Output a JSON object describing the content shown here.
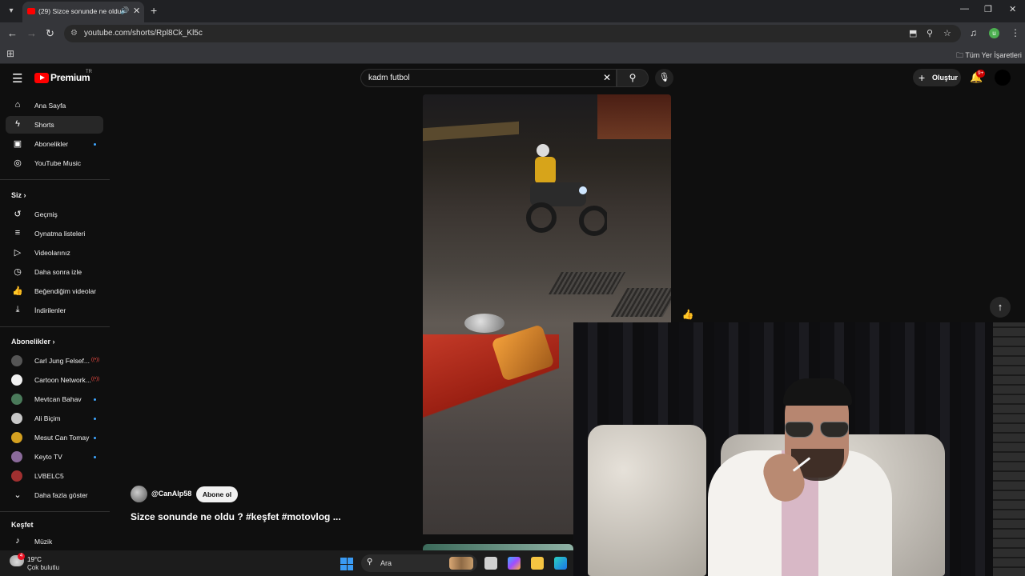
{
  "browser": {
    "tab_title": "(29) Sizce sonunde ne oldu",
    "url": "youtube.com/shorts/Rpl8Ck_Kl5c",
    "bookmarks_all": "Tüm Yer İşaretleri",
    "profile_initial": "u"
  },
  "masthead": {
    "logo_text": "Premium",
    "country_code": "TR",
    "search_query": "kadm futbol",
    "create_label": "Oluştur",
    "notification_count": "9+"
  },
  "sidebar": {
    "main": [
      {
        "label": "Ana Sayfa",
        "icon": "home-icon"
      },
      {
        "label": "Shorts",
        "icon": "shorts-icon"
      },
      {
        "label": "Abonelikler",
        "icon": "subscriptions-icon"
      },
      {
        "label": "YouTube Music",
        "icon": "music-icon"
      }
    ],
    "you_header": "Siz",
    "you": [
      {
        "label": "Geçmiş",
        "icon": "history-icon"
      },
      {
        "label": "Oynatma listeleri",
        "icon": "playlists-icon"
      },
      {
        "label": "Videolarınız",
        "icon": "your-videos-icon"
      },
      {
        "label": "Daha sonra izle",
        "icon": "watch-later-icon"
      },
      {
        "label": "Beğendiğim videolar",
        "icon": "liked-icon"
      },
      {
        "label": "İndirilenler",
        "icon": "downloads-icon"
      }
    ],
    "subs_header": "Abonelikler",
    "subscriptions": [
      {
        "label": "Carl Jung Felsef...",
        "color": "#555555"
      },
      {
        "label": "Cartoon Network...",
        "color": "#f1f1f1"
      },
      {
        "label": "Mevtcan Bahav",
        "color": "#4a7a5a"
      },
      {
        "label": "Ali Biçim",
        "color": "#c8c8c8"
      },
      {
        "label": "Mesut Can Tomay",
        "color": "#d4a020"
      },
      {
        "label": "Keyto TV",
        "color": "#8a6a9a"
      },
      {
        "label": "LVBELC5",
        "color": "#a03030"
      }
    ],
    "show_more": "Daha fazla göster",
    "explore_header": "Keşfet",
    "explore": [
      {
        "label": "Müzik",
        "icon": "music-note-icon"
      }
    ]
  },
  "short": {
    "channel_handle": "@CanAlp58",
    "subscribe_label": "Abone ol",
    "title": "Sizce sonunde ne oldu ? #keşfet #motovlog ..."
  },
  "taskbar": {
    "temp": "19°C",
    "weather": "Çok bulutlu",
    "weather_badge": "4",
    "search_placeholder": "Ara"
  }
}
